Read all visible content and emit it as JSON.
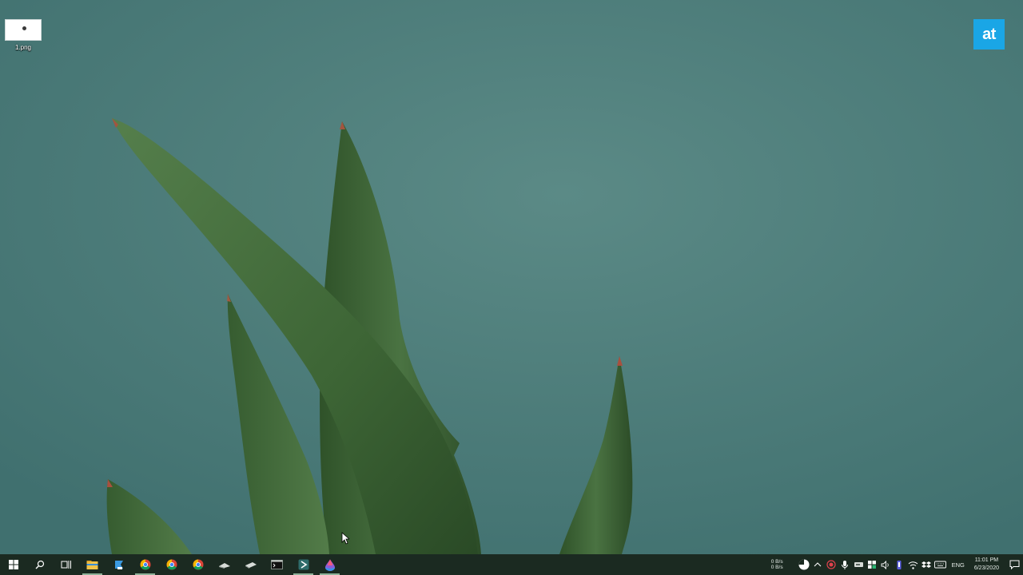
{
  "desktop": {
    "icons": [
      {
        "label": "1.png"
      }
    ]
  },
  "watermark": {
    "text": "at",
    "color": "#1aa6e6"
  },
  "taskbar": {
    "pinned": [
      {
        "name": "start-button",
        "icon": "windows-logo-icon"
      },
      {
        "name": "search-button",
        "icon": "search-icon"
      },
      {
        "name": "task-view-button",
        "icon": "task-view-icon"
      },
      {
        "name": "file-explorer",
        "icon": "folder-icon",
        "active": true
      },
      {
        "name": "app-2",
        "icon": "blue-app-icon"
      },
      {
        "name": "chrome-1",
        "icon": "chrome-icon"
      },
      {
        "name": "chrome-2",
        "icon": "chrome-icon"
      },
      {
        "name": "chrome-3",
        "icon": "chrome-icon"
      },
      {
        "name": "app-6",
        "icon": "gray-app-icon"
      },
      {
        "name": "app-7",
        "icon": "gray-app-icon"
      },
      {
        "name": "terminal",
        "icon": "terminal-icon"
      },
      {
        "name": "app-9",
        "icon": "teal-app-icon",
        "active": true
      },
      {
        "name": "app-10",
        "icon": "colorful-drop-icon",
        "active": true
      }
    ],
    "tray": {
      "net_up": "0 B/s",
      "net_down": "0 B/s",
      "language": "ENG",
      "time": "11:01 PM",
      "date": "6/23/2020"
    }
  },
  "colors": {
    "wallpaper": "#4f7f7d",
    "taskbar": "#1b2a21",
    "leaf_dark": "#2e4f2a",
    "leaf_light": "#4b7443"
  }
}
